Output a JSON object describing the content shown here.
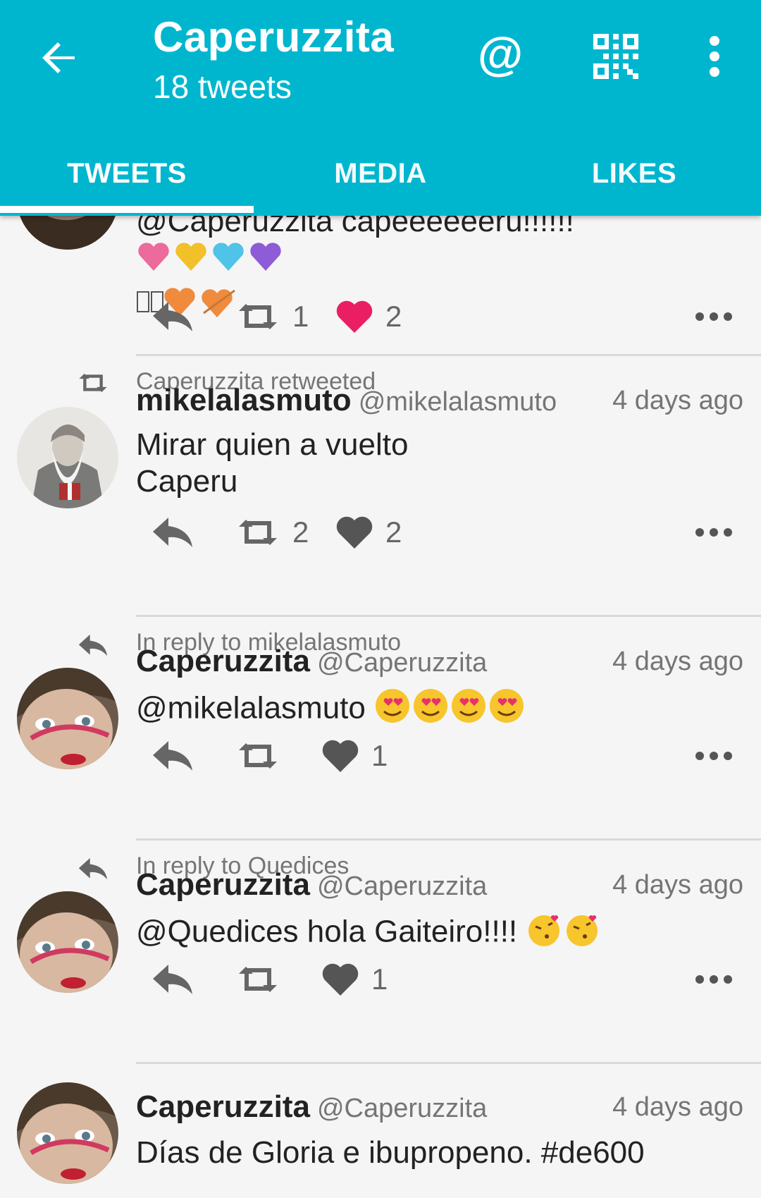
{
  "header": {
    "title": "Caperuzzita",
    "subtitle": "18 tweets",
    "at_label": "@",
    "icons": [
      "back-arrow-icon",
      "at-icon",
      "qr-code-icon",
      "more-vert-icon"
    ]
  },
  "tabs": [
    {
      "label": "TWEETS",
      "selected": true
    },
    {
      "label": "MEDIA",
      "selected": false
    },
    {
      "label": "LIKES",
      "selected": false
    }
  ],
  "colors": {
    "app_bar": "#00B6CF",
    "liked_heart": "#E91E63",
    "text_primary": "#222222",
    "text_secondary": "#757575"
  },
  "tweets": [
    {
      "text_line1": "@Caperuzzita capeeeeeeru!!!!!!",
      "retweets": "1",
      "likes": "2",
      "liked": true
    },
    {
      "context": "Caperuzzita retweeted",
      "context_icon": "retweet-icon",
      "name": "mikelalasmuto",
      "handle": "@mikelalasmuto",
      "time": "4 days ago",
      "text_line1": "Mirar quien a vuelto",
      "text_line2": "Caperu",
      "retweets": "2",
      "likes": "2",
      "liked": false
    },
    {
      "context": "In reply to mikelalasmuto",
      "context_icon": "reply-icon",
      "name": "Caperuzzita",
      "handle": "@Caperuzzita",
      "time": "4 days ago",
      "text": "@mikelalasmuto",
      "emoji": "heart-eyes-emoji",
      "retweets": "",
      "likes": "1",
      "liked": false
    },
    {
      "context": "In reply to Quedices",
      "context_icon": "reply-icon",
      "name": "Caperuzzita",
      "handle": "@Caperuzzita",
      "time": "4 days ago",
      "text": "@Quedices hola Gaiteiro!!!!",
      "emoji": "kissing-heart-emoji",
      "retweets": "",
      "likes": "1",
      "liked": false
    },
    {
      "name": "Caperuzzita",
      "handle": "@Caperuzzita",
      "time": "4 days ago",
      "text": "Días de Gloria e ibupropeno. #de600"
    }
  ]
}
